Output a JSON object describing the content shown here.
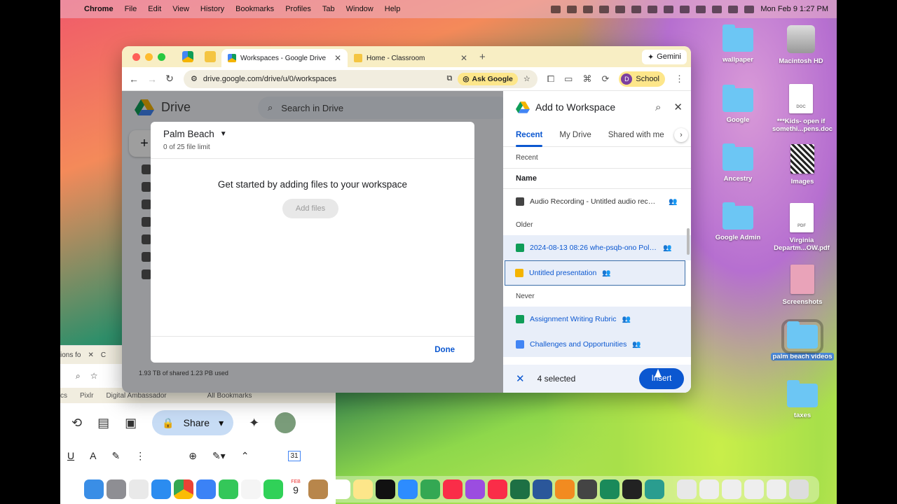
{
  "menubar": {
    "app": "Chrome",
    "items": [
      "File",
      "Edit",
      "View",
      "History",
      "Bookmarks",
      "Profiles",
      "Tab",
      "Window",
      "Help"
    ],
    "clock": "Mon Feb 9  1:27 PM"
  },
  "chrome": {
    "tabs": [
      {
        "title": "Workspaces - Google Drive",
        "active": true
      },
      {
        "title": "Home - Classroom",
        "active": false
      }
    ],
    "gemini": "Gemini",
    "url": "drive.google.com/drive/u/0/workspaces",
    "ask_google": "Ask Google",
    "profile": {
      "initial": "D",
      "label": "School"
    }
  },
  "drive": {
    "title": "Drive",
    "search_placeholder": "Search in Drive",
    "storage": "1.93 TB of shared 1.23 PB used"
  },
  "workspace_modal": {
    "name": "Palm Beach",
    "limit": "0 of 25 file limit",
    "empty_text": "Get started by adding files to your workspace",
    "add_files": "Add files",
    "done": "Done"
  },
  "picker": {
    "title": "Add to Workspace",
    "tabs": [
      "Recent",
      "My Drive",
      "Shared with me"
    ],
    "section_recent": "Recent",
    "column": "Name",
    "recent_files": [
      {
        "name": "Audio Recording - Untitled audio recordin...",
        "type": "audio",
        "selected": false
      }
    ],
    "section_older": "Older",
    "older_files": [
      {
        "name": "2024-08-13 08:26 whe-psqb-ono Polling ...",
        "type": "sheet",
        "selected": true
      },
      {
        "name": "Untitled presentation",
        "type": "slides",
        "selected": true
      }
    ],
    "section_never": "Never",
    "never_files": [
      {
        "name": "Assignment Writing Rubric",
        "type": "sheet",
        "selected": true
      },
      {
        "name": "Challenges and Opportunities",
        "type": "doc",
        "selected": true
      }
    ],
    "selected_count": "4 selected",
    "insert": "Insert"
  },
  "bg_window": {
    "tab1": "ions fo",
    "tab2": "C",
    "bookmarks": [
      "cs",
      "Pixlr",
      "Digital Ambassador",
      "All Bookmarks"
    ],
    "share": "Share",
    "calendar_day": "31"
  },
  "desktop": {
    "icons": [
      "wallpaper",
      "Macintosh HD",
      "Google",
      "***Kids- open if somethi...pens.doc",
      "Ancestry",
      "Images",
      "Google Admin",
      "Virginia Departm...OW.pdf",
      "Screenshots",
      "palm beach videos",
      "taxes"
    ],
    "doc_label": "DOC",
    "pdf_label": "PDF"
  },
  "colors": {
    "accent": "#0b57d0",
    "sheet": "#0f9d58",
    "slides": "#f4b400",
    "doc": "#4285f4"
  },
  "dock": {
    "date_month": "FEB",
    "date_day": "9"
  }
}
